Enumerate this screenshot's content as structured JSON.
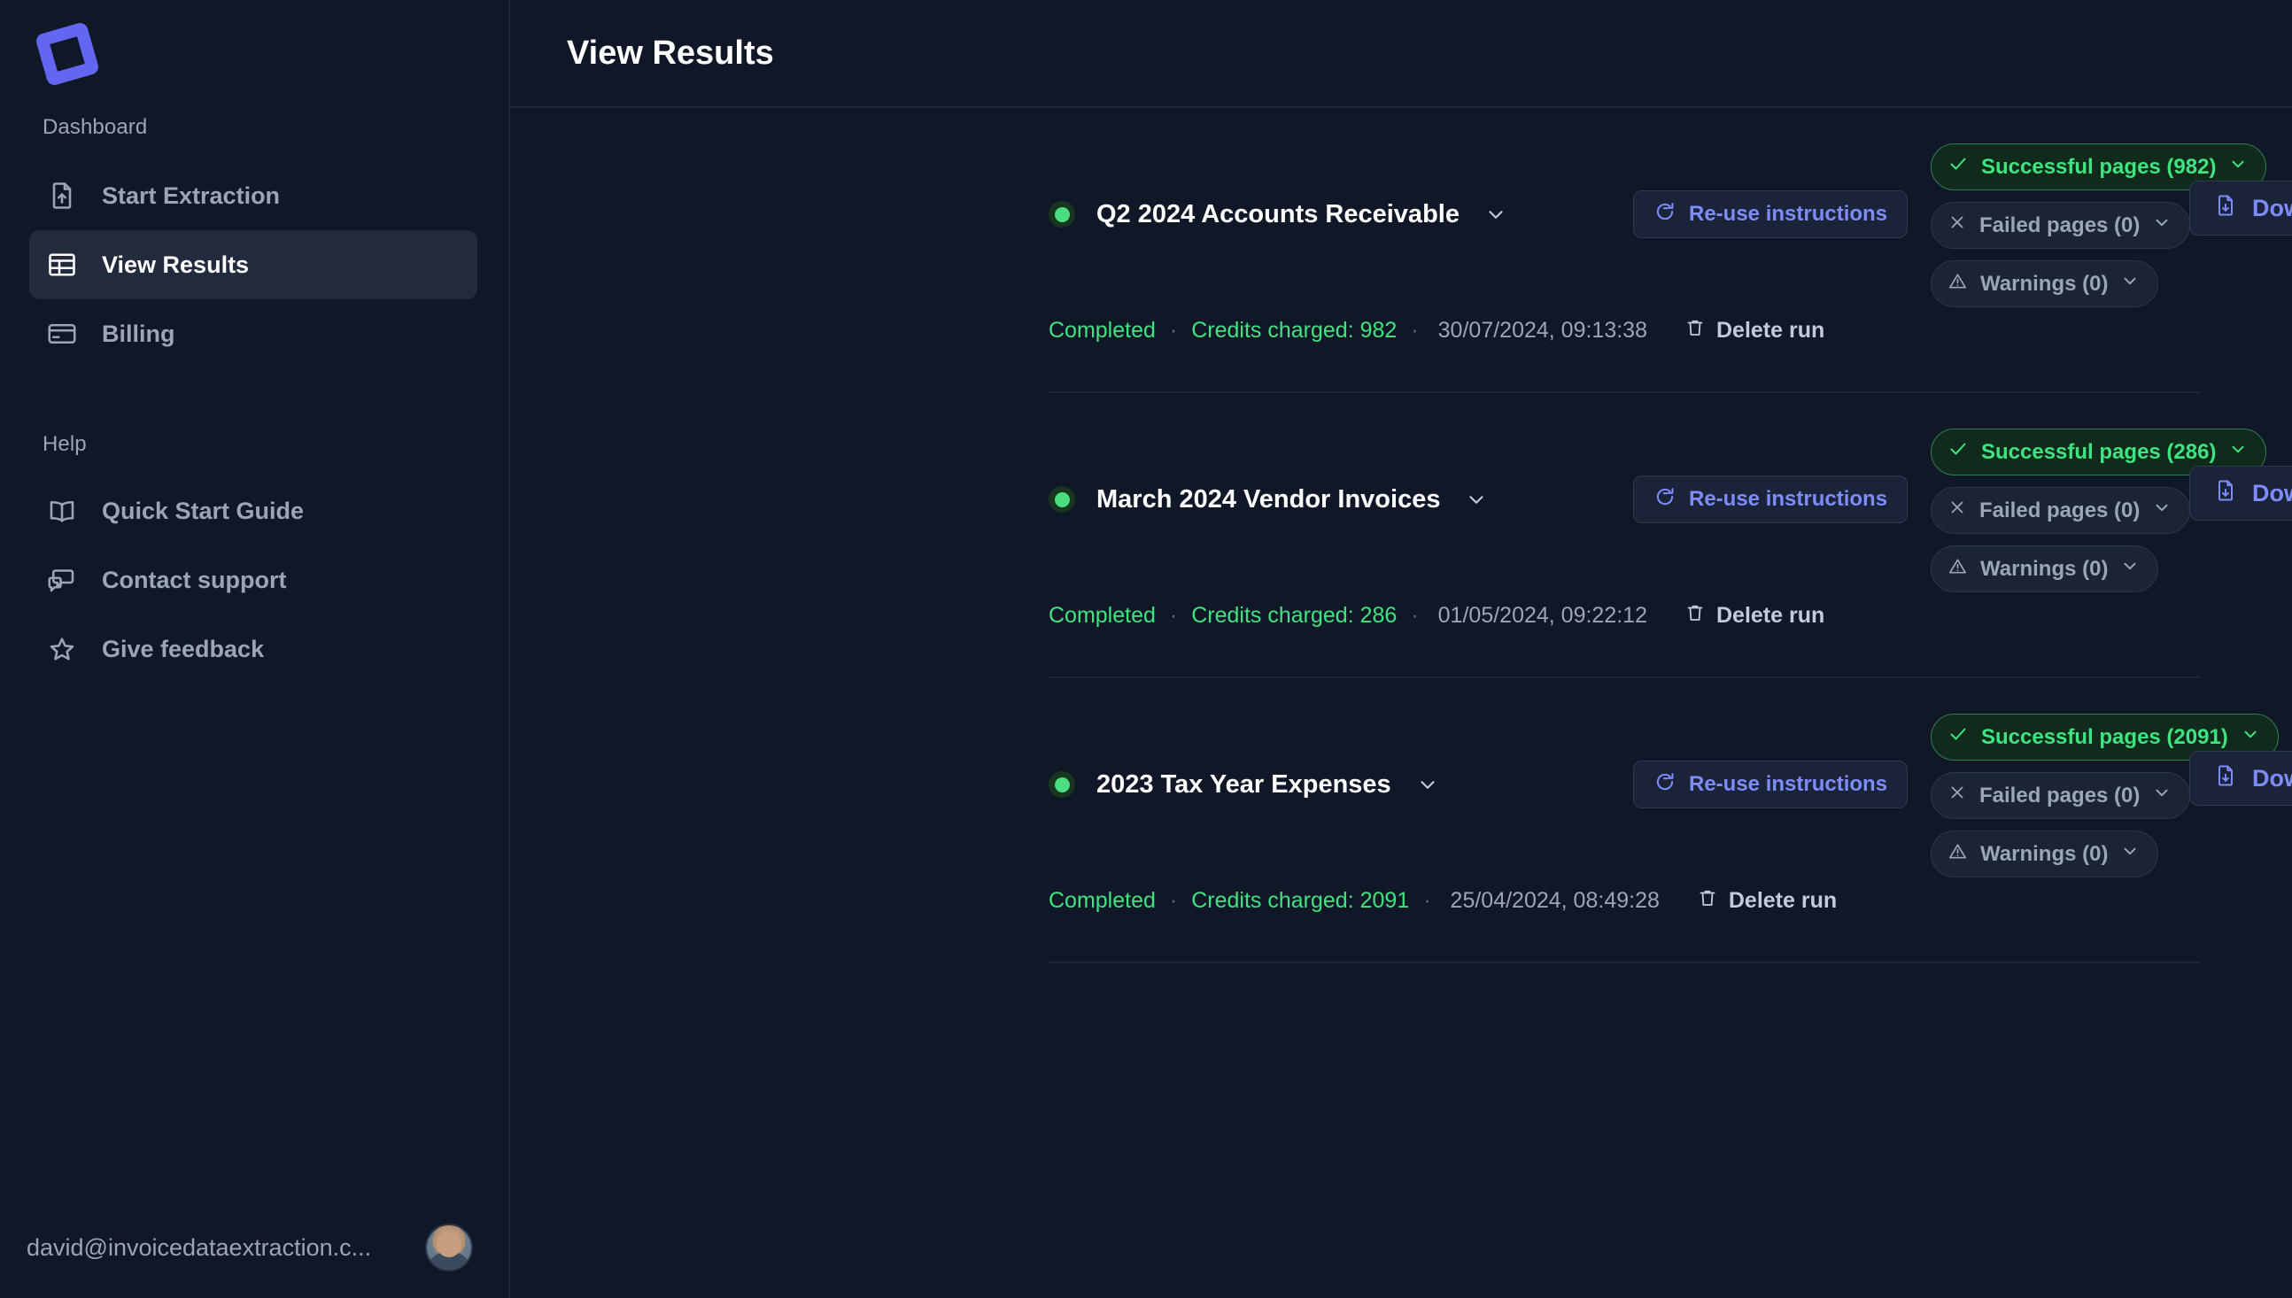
{
  "brand": {
    "logo_name": "app-logo",
    "logo_color": "#6366f1"
  },
  "sidebar": {
    "sections": [
      {
        "label": "Dashboard",
        "items": [
          {
            "label": "Start Extraction",
            "icon": "file-upload-icon",
            "active": false
          },
          {
            "label": "View Results",
            "icon": "table-icon",
            "active": true
          },
          {
            "label": "Billing",
            "icon": "credit-card-icon",
            "active": false
          }
        ]
      },
      {
        "label": "Help",
        "items": [
          {
            "label": "Quick Start Guide",
            "icon": "book-open-icon",
            "active": false
          },
          {
            "label": "Contact support",
            "icon": "chat-bubbles-icon",
            "active": false
          },
          {
            "label": "Give feedback",
            "icon": "star-icon",
            "active": false
          }
        ]
      }
    ],
    "user": {
      "email": "david@invoicedataextraction.c...",
      "avatar_name": "user-avatar"
    }
  },
  "header": {
    "title": "View Results"
  },
  "buttons": {
    "reuse_label": "Re-use instructions",
    "download_label": "Download spreadsheet",
    "delete_label": "Delete run"
  },
  "colors": {
    "accent": "#7c8cfb",
    "success": "#3ee47f",
    "muted": "#9aa5b8",
    "surface": "#101828",
    "sidebar_active": "#212b3d"
  },
  "runs": [
    {
      "name": "Q2 2024 Accounts Receivable",
      "status_dot": "status-dot-success",
      "badges": {
        "successful": "Successful pages (982)",
        "failed": "Failed pages (0)",
        "warnings": "Warnings (0)"
      },
      "status_text": "Completed",
      "credits": "Credits charged: 982",
      "timestamp": "30/07/2024, 09:13:38"
    },
    {
      "name": "March 2024 Vendor Invoices",
      "status_dot": "status-dot-success",
      "badges": {
        "successful": "Successful pages (286)",
        "failed": "Failed pages (0)",
        "warnings": "Warnings (0)"
      },
      "status_text": "Completed",
      "credits": "Credits charged: 286",
      "timestamp": "01/05/2024, 09:22:12"
    },
    {
      "name": "2023 Tax Year Expenses",
      "status_dot": "status-dot-success",
      "badges": {
        "successful": "Successful pages (2091)",
        "failed": "Failed pages (0)",
        "warnings": "Warnings (0)"
      },
      "status_text": "Completed",
      "credits": "Credits charged: 2091",
      "timestamp": "25/04/2024, 08:49:28"
    }
  ]
}
